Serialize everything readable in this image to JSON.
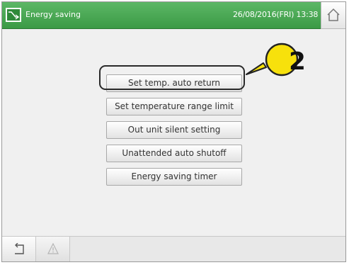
{
  "header": {
    "title": "Energy saving",
    "datetime": "26/08/2016(FRI) 13:38"
  },
  "menu": {
    "items": [
      {
        "label": "Set temp. auto return"
      },
      {
        "label": "Set temperature range limit"
      },
      {
        "label": "Out unit silent setting"
      },
      {
        "label": "Unattended auto shutoff"
      },
      {
        "label": "Energy saving timer"
      }
    ]
  },
  "annotation": {
    "callout_number": "2"
  },
  "icons": {
    "title": "energy-saving-icon",
    "home": "home-icon",
    "back": "back-arrow-icon",
    "warning": "warning-icon"
  },
  "colors": {
    "header_green": "#4aa954",
    "button_text": "#333333"
  }
}
